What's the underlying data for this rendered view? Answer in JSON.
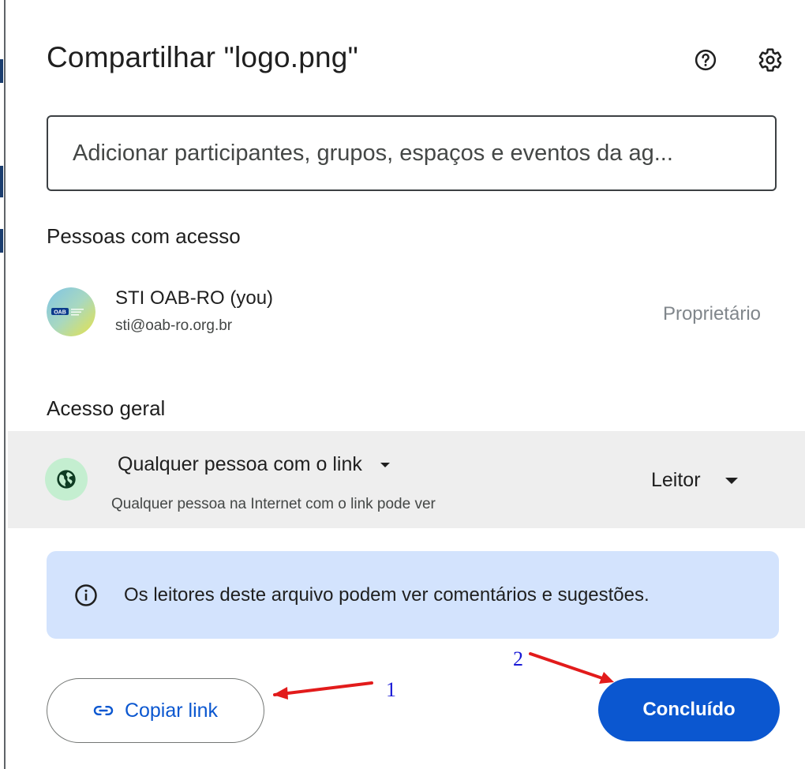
{
  "dialog": {
    "title": "Compartilhar \"logo.png\"",
    "help_icon": "help-circle-icon",
    "settings_icon": "gear-icon"
  },
  "search": {
    "placeholder": "Adicionar participantes, grupos, espaços e eventos da ag..."
  },
  "people_section": {
    "heading": "Pessoas com acesso",
    "people": [
      {
        "name": "STI OAB-RO (you)",
        "email": "sti@oab-ro.org.br",
        "role": "Proprietário",
        "avatar_text": "OAB"
      }
    ]
  },
  "general_access": {
    "heading": "Acesso geral",
    "type_label": "Qualquer pessoa com o link",
    "description": "Qualquer pessoa na Internet com o link pode ver",
    "role_label": "Leitor",
    "icon": "globe-icon"
  },
  "info_banner": {
    "icon": "info-icon",
    "text": "Os leitores deste arquivo podem ver comentários e sugestões."
  },
  "actions": {
    "copy_link_label": "Copiar link",
    "copy_link_icon": "link-icon",
    "done_label": "Concluído"
  },
  "annotations": {
    "label_1": "1",
    "label_2": "2",
    "arrow_color": "#e21b1b",
    "number_color": "#1a1ad6"
  },
  "colors": {
    "primary": "#0b57d0",
    "banner_bg": "#d3e3fd",
    "access_row_bg": "#eeeeee",
    "globe_bg": "#c4eed0"
  }
}
